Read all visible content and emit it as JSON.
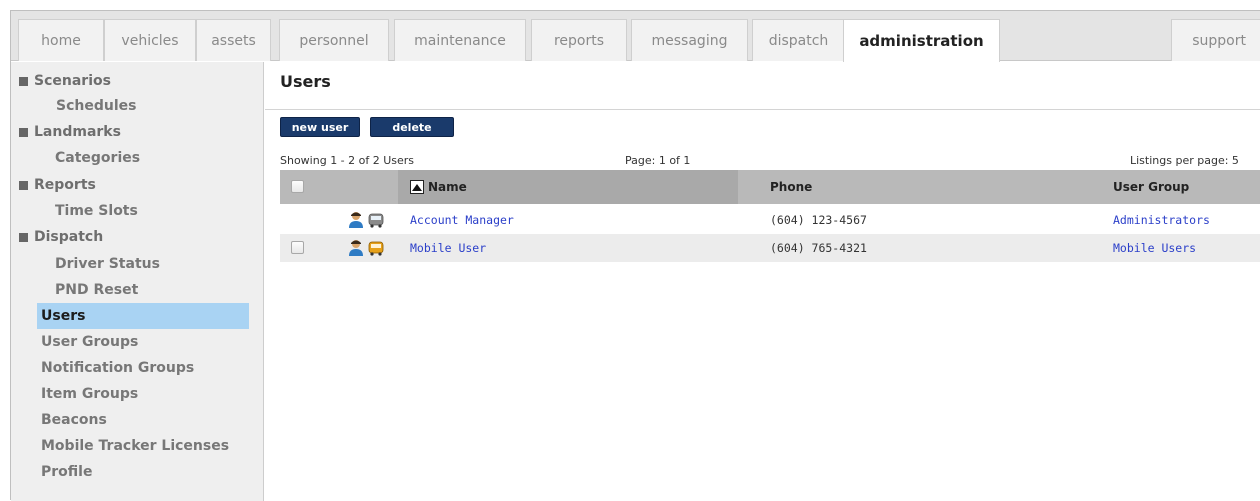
{
  "tabs": [
    {
      "label": "home"
    },
    {
      "label": "vehicles"
    },
    {
      "label": "assets"
    },
    {
      "label": "personnel"
    },
    {
      "label": "maintenance"
    },
    {
      "label": "reports"
    },
    {
      "label": "messaging"
    },
    {
      "label": "dispatch"
    },
    {
      "label": "administration",
      "active": true
    },
    {
      "label": "support"
    }
  ],
  "sidebar": {
    "items": [
      {
        "label": "Scenarios",
        "kind": "section"
      },
      {
        "label": "Schedules",
        "kind": "sub"
      },
      {
        "label": "Landmarks",
        "kind": "section"
      },
      {
        "label": "Categories",
        "kind": "sub"
      },
      {
        "label": "Reports",
        "kind": "section"
      },
      {
        "label": "Time Slots",
        "kind": "sub"
      },
      {
        "label": "Dispatch",
        "kind": "section"
      },
      {
        "label": "Driver Status",
        "kind": "sub"
      },
      {
        "label": "PND Reset",
        "kind": "sub"
      },
      {
        "label": "Users",
        "kind": "plain",
        "selected": true
      },
      {
        "label": "User Groups",
        "kind": "plain"
      },
      {
        "label": "Notification Groups",
        "kind": "plain"
      },
      {
        "label": "Item Groups",
        "kind": "plain"
      },
      {
        "label": "Beacons",
        "kind": "plain"
      },
      {
        "label": "Mobile Tracker Licenses",
        "kind": "plain"
      },
      {
        "label": "Profile",
        "kind": "plain"
      }
    ]
  },
  "main": {
    "title": "Users",
    "buttons": {
      "new_user": "new user",
      "delete": "delete"
    },
    "showing": "Showing 1 - 2 of 2 Users",
    "page": "Page: 1 of 1",
    "listings": "Listings per page: 5",
    "columns": {
      "name": "Name",
      "phone": "Phone",
      "group": "User Group"
    },
    "rows": [
      {
        "name": "Account Manager",
        "phone": "(604) 123-4567",
        "group": "Administrators",
        "vehicle_color": "#8a8a8a",
        "has_checkbox": false
      },
      {
        "name": "Mobile User",
        "phone": "(604) 765-4321",
        "group": "Mobile Users",
        "vehicle_color": "#e6a11a",
        "has_checkbox": true
      }
    ]
  },
  "colors": {
    "accent_button": "#1a3a6b",
    "selected_sidebar": "#a9d3f3",
    "link": "#2b3fc9"
  }
}
